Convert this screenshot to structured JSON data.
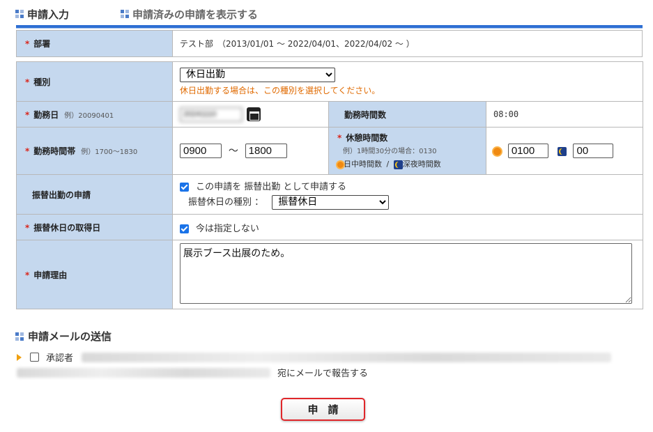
{
  "tabs": {
    "input_label": "申請入力",
    "show_submitted_label": "申請済みの申請を表示する"
  },
  "department": {
    "required_mark": "*",
    "label": "部署",
    "value": "テスト部　（2013/01/01 ～ 2022/04/01、2022/04/02 ～ ）"
  },
  "type": {
    "required_mark": "*",
    "label": "種別",
    "selected": "休日出勤",
    "note": "休日出勤する場合は、この種別を選択してください。"
  },
  "work_date": {
    "required_mark": "*",
    "label": "勤務日",
    "example": "例）20090401",
    "value": "20241110"
  },
  "work_hours": {
    "label": "勤務時間数",
    "value": "08:00"
  },
  "work_time_range": {
    "required_mark": "*",
    "label": "勤務時間帯",
    "example": "例）1700～1830",
    "start": "0900",
    "separator": "～",
    "end": "1800"
  },
  "break_hours": {
    "required_mark": "*",
    "label": "休憩時間数",
    "example": "例）1時間30分の場合：0130",
    "day_legend": "日中時間数",
    "slash": "/",
    "night_legend": "深夜時間数",
    "day_value": "0100",
    "night_value": "00"
  },
  "substitute_request": {
    "label": "振替出勤の申請",
    "checkbox_text": "この申請を 振替出勤 として申請する",
    "holiday_type_label": "振替休日の種別 ：",
    "holiday_type_selected": "振替休日"
  },
  "substitute_date": {
    "required_mark": "*",
    "label": "振替休日の取得日",
    "checkbox_text": "今は指定しない"
  },
  "reason": {
    "required_mark": "*",
    "label": "申請理由",
    "value": "展示ブース出展のため。"
  },
  "mail": {
    "heading": "申請メールの送信",
    "approver_label": "承認者",
    "report_suffix": "宛にメールで報告する"
  },
  "submit": {
    "label": "申請"
  },
  "colors": {
    "accent_blue": "#2e6fd3",
    "label_bg": "#c5d8ee",
    "required_red": "#d9261c",
    "note_orange": "#e06a00",
    "button_border": "#e0262a"
  }
}
